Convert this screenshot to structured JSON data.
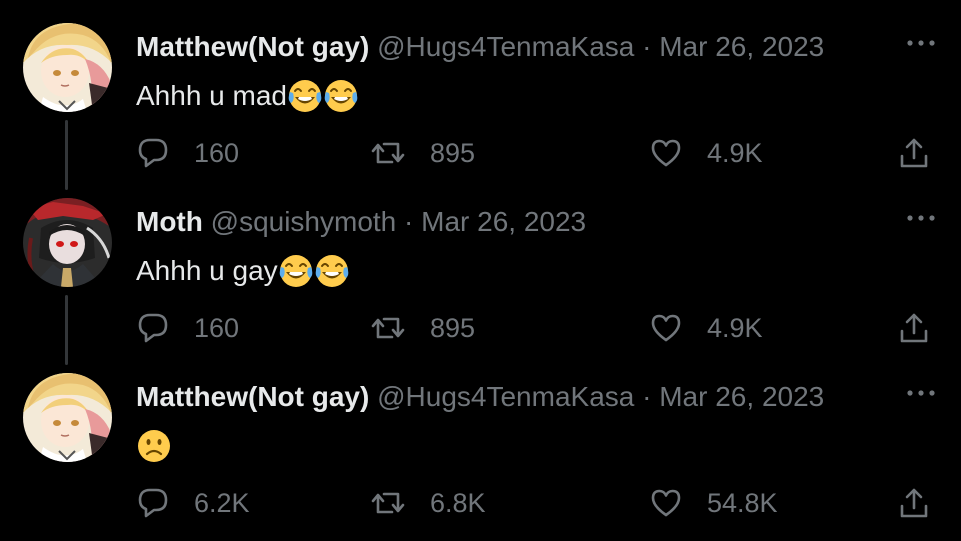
{
  "tweets": [
    {
      "display_name": "Matthew(Not gay)",
      "handle": "@Hugs4TenmaKasa",
      "separator": "·",
      "date": "Mar 26, 2023",
      "text": "Ahhh u mad",
      "emojis": [
        "face-with-tears-of-joy",
        "face-with-tears-of-joy"
      ],
      "replies": "160",
      "retweets": "895",
      "likes": "4.9K",
      "avatar": "blonde-anime-avatar"
    },
    {
      "display_name": "Moth",
      "handle": "@squishymoth",
      "separator": "·",
      "date": "Mar 26, 2023",
      "text": "Ahhh u gay",
      "emojis": [
        "face-with-tears-of-joy",
        "face-with-tears-of-joy"
      ],
      "replies": "160",
      "retweets": "895",
      "likes": "4.9K",
      "avatar": "dark-anime-avatar"
    },
    {
      "display_name": "Matthew(Not gay)",
      "handle": "@Hugs4TenmaKasa",
      "separator": "·",
      "date": "Mar 26, 2023",
      "text": "",
      "emojis": [
        "slightly-frowning-face"
      ],
      "replies": "6.2K",
      "retweets": "6.8K",
      "likes": "54.8K",
      "avatar": "blonde-anime-avatar"
    }
  ],
  "colors": {
    "background": "#000000",
    "primary_text": "#e7e9ea",
    "secondary_text": "#71767b",
    "thread_line": "#333639",
    "emoji_yellow": "#ffcc4d"
  },
  "icons": {
    "reply": "reply-icon",
    "retweet": "retweet-icon",
    "like": "heart-icon",
    "share": "share-icon",
    "more": "more-icon"
  }
}
